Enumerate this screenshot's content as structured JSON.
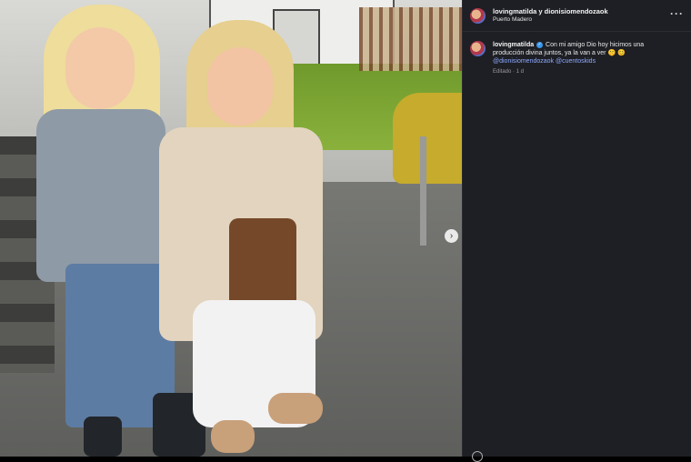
{
  "header": {
    "title": "lovingmatilda y dionisiomendozaok",
    "location": "Puerto Madero",
    "more": "···"
  },
  "caption": {
    "username": "lovingmatilda",
    "verified_glyph": "✓",
    "text": "Con mi amigo Dio hoy hicimos una producción divina juntos, ya la van a ver 🤫 😊",
    "mention_1": "@dionisiomendozaok",
    "mention_2": "@cuentoskids",
    "edited": "Editado · 1 d"
  },
  "media": {
    "next_glyph": "›"
  },
  "icons": {
    "avatar": "avatar-icon",
    "more": "more-icon",
    "next": "chevron-right-icon",
    "verified": "verified-badge-icon"
  },
  "colors": {
    "panel_bg": "#1e1f24",
    "mention": "#8ea9ff",
    "verified": "#3897f0"
  }
}
